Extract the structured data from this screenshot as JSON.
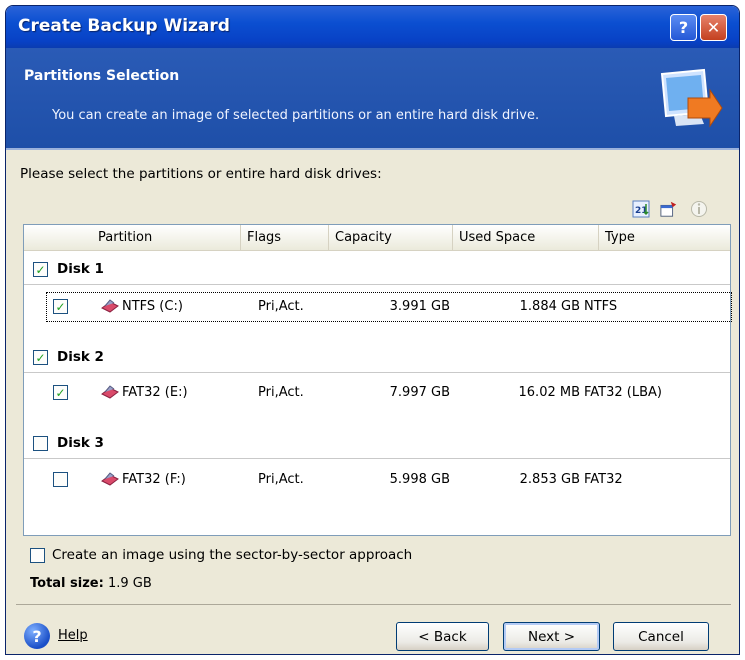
{
  "window": {
    "title": "Create Backup Wizard",
    "help_glyph": "?",
    "close_glyph": "✕"
  },
  "header": {
    "title": "Partitions Selection",
    "subtitle": "You can create an image of selected partitions or an entire hard disk drive."
  },
  "prompt": "Please select the partitions or entire hard disk drives:",
  "toolbar_icons": [
    "sort-icon",
    "properties-icon",
    "info-icon"
  ],
  "columns": [
    "Partition",
    "Flags",
    "Capacity",
    "Used Space",
    "Type"
  ],
  "disks": [
    {
      "label": "Disk 1",
      "checked": true,
      "partitions": [
        {
          "name": "NTFS (C:)",
          "flags": "Pri,Act.",
          "capacity": "3.991 GB",
          "used": "1.884 GB",
          "type": "NTFS",
          "checked": true,
          "selected": true
        }
      ]
    },
    {
      "label": "Disk 2",
      "checked": true,
      "partitions": [
        {
          "name": "FAT32 (E:)",
          "flags": "Pri,Act.",
          "capacity": "7.997 GB",
          "used": "16.02 MB",
          "type": "FAT32 (LBA)",
          "checked": true,
          "selected": false
        }
      ]
    },
    {
      "label": "Disk 3",
      "checked": false,
      "partitions": [
        {
          "name": "FAT32 (F:)",
          "flags": "Pri,Act.",
          "capacity": "5.998 GB",
          "used": "2.853 GB",
          "type": "FAT32",
          "checked": false,
          "selected": false
        }
      ]
    }
  ],
  "sector_option": {
    "label": "Create an image using the sector-by-sector approach",
    "checked": false
  },
  "total": {
    "label": "Total size:",
    "value": "1.9 GB"
  },
  "footer": {
    "help": "Help",
    "back": "< Back",
    "next": "Next >",
    "cancel": "Cancel"
  },
  "check_glyph": "✓",
  "colors": {
    "titlebar": "#0b4fd1",
    "header": "#1e4fa8",
    "window_bg": "#ece9d8",
    "check_green": "#21a121"
  }
}
